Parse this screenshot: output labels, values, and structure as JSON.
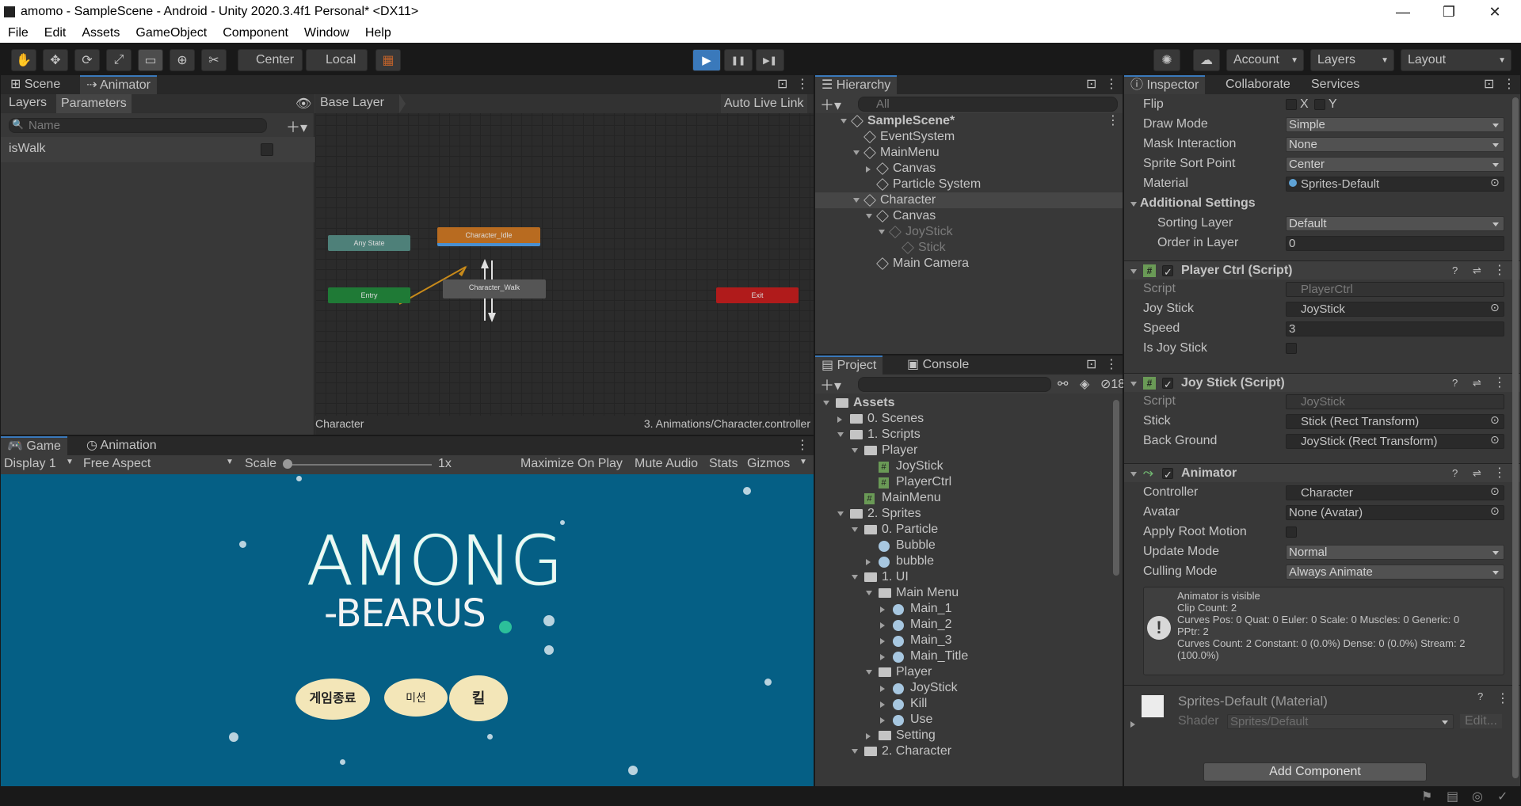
{
  "window": {
    "title": "amomo - SampleScene - Android - Unity 2020.3.4f1 Personal* <DX11>",
    "minimize": "—",
    "restore": "❐",
    "close": "✕"
  },
  "menu": [
    "File",
    "Edit",
    "Assets",
    "GameObject",
    "Component",
    "Window",
    "Help"
  ],
  "toolbar": {
    "tool_icons": [
      "✋",
      "✥",
      "⟳",
      "⤢",
      "▭",
      "⊕",
      "✂"
    ],
    "pivot": "Center",
    "space": "Local",
    "snap": "▦",
    "play": "▶",
    "pause": "❚❚",
    "step": "▶❚",
    "account": "Account",
    "layers": "Layers",
    "layout": "Layout"
  },
  "scene_panel": {
    "tabs": [
      "Scene",
      "Animator"
    ],
    "sub_tabs": [
      "Layers",
      "Parameters"
    ],
    "search_placeholder": "Name",
    "parameters": [
      {
        "name": "isWalk",
        "checked": false
      }
    ],
    "breadcrumb": "Base Layer",
    "auto_live_link": "Auto Live Link",
    "nodes": {
      "any_state": "Any State",
      "idle": "Character_Idle",
      "walk": "Character_Walk",
      "entry": "Entry",
      "exit": "Exit"
    },
    "footer_left": "Character",
    "footer_right": "3. Animations/Character.controller"
  },
  "game_panel": {
    "tabs": [
      "Game",
      "Animation"
    ],
    "display": "Display 1",
    "aspect": "Free Aspect",
    "scale_label": "Scale",
    "scale_value": "1x",
    "buttons": [
      "Maximize On Play",
      "Mute Audio",
      "Stats",
      "Gizmos"
    ],
    "game_title_1": "AMONG",
    "game_title_2": "-BEARUS",
    "fish_buttons": [
      "게임종료",
      "미션",
      "킬"
    ],
    "bg_color": "#055f85"
  },
  "hierarchy": {
    "tab": "Hierarchy",
    "search_placeholder": "All",
    "items": [
      {
        "label": "SampleScene*",
        "indent": 0
      },
      {
        "label": "EventSystem",
        "indent": 1
      },
      {
        "label": "MainMenu",
        "indent": 1
      },
      {
        "label": "Canvas",
        "indent": 2
      },
      {
        "label": "Particle System",
        "indent": 2
      },
      {
        "label": "Character",
        "indent": 1
      },
      {
        "label": "Canvas",
        "indent": 2
      },
      {
        "label": "JoyStick",
        "indent": 3
      },
      {
        "label": "Stick",
        "indent": 4
      },
      {
        "label": "Main Camera",
        "indent": 2
      }
    ]
  },
  "project": {
    "tabs": [
      "Project",
      "Console"
    ],
    "hidden_count": "18",
    "items": [
      {
        "label": "Assets",
        "indent": 0
      },
      {
        "label": "0. Scenes",
        "indent": 1
      },
      {
        "label": "1. Scripts",
        "indent": 1
      },
      {
        "label": "Player",
        "indent": 2
      },
      {
        "label": "JoyStick",
        "indent": 3
      },
      {
        "label": "PlayerCtrl",
        "indent": 3
      },
      {
        "label": "MainMenu",
        "indent": 2
      },
      {
        "label": "2. Sprites",
        "indent": 1
      },
      {
        "label": "0. Particle",
        "indent": 2
      },
      {
        "label": "Bubble",
        "indent": 3
      },
      {
        "label": "bubble",
        "indent": 3
      },
      {
        "label": "1. UI",
        "indent": 2
      },
      {
        "label": "Main Menu",
        "indent": 3
      },
      {
        "label": "Main_1",
        "indent": 4
      },
      {
        "label": "Main_2",
        "indent": 4
      },
      {
        "label": "Main_3",
        "indent": 4
      },
      {
        "label": "Main_Title",
        "indent": 4
      },
      {
        "label": "Player",
        "indent": 3
      },
      {
        "label": "JoyStick",
        "indent": 4
      },
      {
        "label": "Kill",
        "indent": 4
      },
      {
        "label": "Use",
        "indent": 4
      },
      {
        "label": "Setting",
        "indent": 3
      },
      {
        "label": "2. Character",
        "indent": 2
      }
    ]
  },
  "inspector": {
    "tabs": [
      "Inspector",
      "Collaborate",
      "Services"
    ],
    "sprite": {
      "flip_label": "Flip",
      "flip_x": "X",
      "flip_y": "Y",
      "draw_mode_label": "Draw Mode",
      "draw_mode": "Simple",
      "mask_label": "Mask Interaction",
      "mask": "None",
      "sort_point_label": "Sprite Sort Point",
      "sort_point": "Center",
      "material_label": "Material",
      "material": "Sprites-Default",
      "additional": "Additional Settings",
      "sorting_layer_label": "Sorting Layer",
      "sorting_layer": "Default",
      "order_label": "Order in Layer",
      "order": "0"
    },
    "player_ctrl": {
      "title": "Player Ctrl (Script)",
      "script_label": "Script",
      "script": "PlayerCtrl",
      "joystick_label": "Joy Stick",
      "joystick": "JoyStick",
      "speed_label": "Speed",
      "speed": "3",
      "is_joystick_label": "Is Joy Stick"
    },
    "joy_stick": {
      "title": "Joy Stick (Script)",
      "script_label": "Script",
      "script": "JoyStick",
      "stick_label": "Stick",
      "stick": "Stick (Rect Transform)",
      "background_label": "Back Ground",
      "background": "JoyStick (Rect Transform)"
    },
    "animator": {
      "title": "Animator",
      "controller_label": "Controller",
      "controller": "Character",
      "avatar_label": "Avatar",
      "avatar": "None (Avatar)",
      "root_motion_label": "Apply Root Motion",
      "update_mode_label": "Update Mode",
      "update_mode": "Normal",
      "culling_label": "Culling Mode",
      "culling": "Always Animate",
      "info": [
        "Animator is visible",
        "Clip Count: 2",
        "Curves Pos: 0 Quat: 0 Euler: 0 Scale: 0 Muscles: 0 Generic: 0",
        "PPtr: 2",
        "Curves Count: 2 Constant: 0 (0.0%) Dense: 0 (0.0%) Stream: 2",
        "(100.0%)"
      ]
    },
    "material": {
      "title": "Sprites-Default (Material)",
      "shader_label": "Shader",
      "shader": "Sprites/Default",
      "edit": "Edit..."
    },
    "add_component": "Add Component"
  }
}
